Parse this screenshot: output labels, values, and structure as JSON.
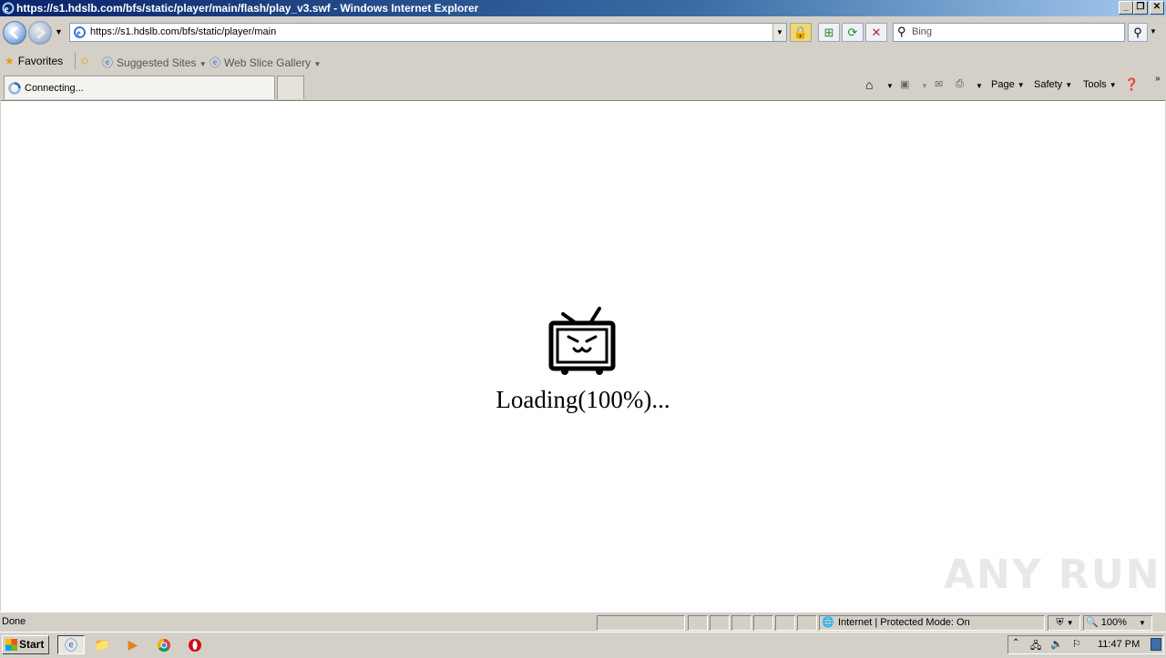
{
  "window": {
    "title": "https://s1.hdslb.com/bfs/static/player/main/flash/play_v3.swf - Windows Internet Explorer",
    "minimize": "_",
    "restore": "❐",
    "close": "✕"
  },
  "address_bar": {
    "url": "https://s1.hdslb.com/bfs/static/player/main",
    "search_placeholder": "Bing"
  },
  "favorites_bar": {
    "favorites_label": "Favorites",
    "suggested_sites": "Suggested Sites",
    "web_slice_gallery": "Web Slice Gallery"
  },
  "tabs": [
    {
      "label": "Connecting..."
    }
  ],
  "command_bar": {
    "page": "Page",
    "safety": "Safety",
    "tools": "Tools"
  },
  "content": {
    "loading_text": "Loading(100%)...",
    "watermark": "ANY RUN"
  },
  "status_bar": {
    "status": "Done",
    "zone": "Internet | Protected Mode: On",
    "zoom": "100%"
  },
  "taskbar": {
    "start_label": "Start",
    "clock": "11:47 PM"
  }
}
